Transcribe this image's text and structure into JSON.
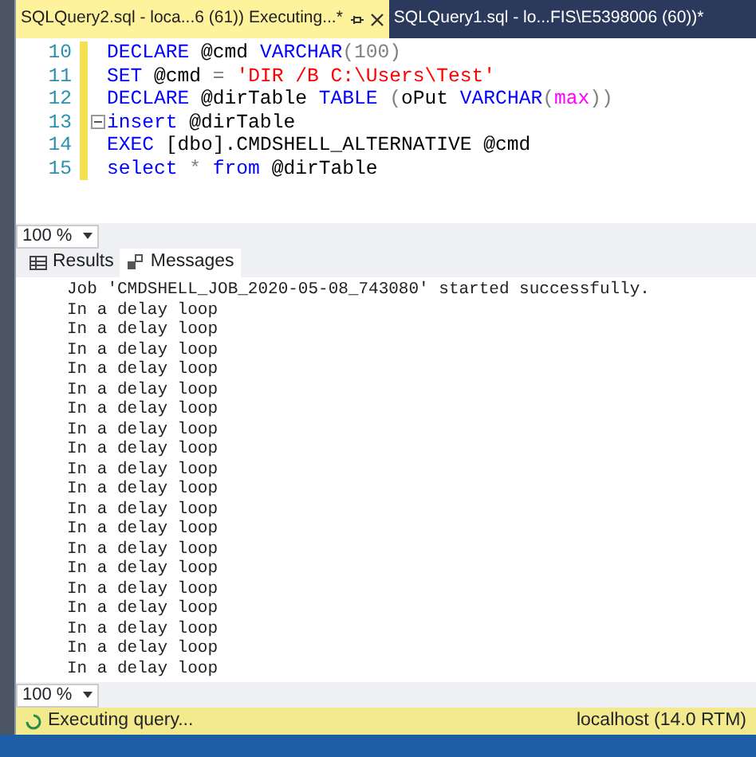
{
  "tabs": [
    {
      "label": "SQLQuery2.sql - loca...6 (61)) Executing...*",
      "selected": true
    },
    {
      "label": "SQLQuery1.sql - lo...FIS\\E5398006 (60))*",
      "selected": false
    }
  ],
  "editor": {
    "lines": [
      {
        "number": "10",
        "collapsible": false,
        "tokens": [
          {
            "text": "DECLARE",
            "kind": "keyword"
          },
          {
            "text": " @cmd ",
            "kind": "plain"
          },
          {
            "text": "VARCHAR",
            "kind": "keyword"
          },
          {
            "text": "(100)",
            "kind": "operator"
          }
        ]
      },
      {
        "number": "11",
        "collapsible": false,
        "tokens": [
          {
            "text": "SET",
            "kind": "keyword"
          },
          {
            "text": " @cmd ",
            "kind": "plain"
          },
          {
            "text": "=",
            "kind": "operator"
          },
          {
            "text": " 'DIR /B C:\\Users\\Test'",
            "kind": "string"
          }
        ]
      },
      {
        "number": "12",
        "collapsible": false,
        "tokens": [
          {
            "text": "DECLARE",
            "kind": "keyword"
          },
          {
            "text": " @dirTable ",
            "kind": "plain"
          },
          {
            "text": "TABLE",
            "kind": "keyword"
          },
          {
            "text": " (",
            "kind": "operator"
          },
          {
            "text": "oPut ",
            "kind": "plain"
          },
          {
            "text": "VARCHAR",
            "kind": "keyword"
          },
          {
            "text": "(",
            "kind": "operator"
          },
          {
            "text": "max",
            "kind": "function"
          },
          {
            "text": "))",
            "kind": "operator"
          }
        ]
      },
      {
        "number": "13",
        "collapsible": true,
        "tokens": [
          {
            "text": "insert",
            "kind": "keyword"
          },
          {
            "text": " @dirTable",
            "kind": "plain"
          }
        ]
      },
      {
        "number": "14",
        "collapsible": false,
        "tokens": [
          {
            "text": "EXEC",
            "kind": "keyword"
          },
          {
            "text": " [dbo].CMDSHELL_ALTERNATIVE @cmd",
            "kind": "plain"
          }
        ]
      },
      {
        "number": "15",
        "collapsible": false,
        "tokens": [
          {
            "text": "select",
            "kind": "keyword"
          },
          {
            "text": " * ",
            "kind": "operator"
          },
          {
            "text": "from",
            "kind": "keyword"
          },
          {
            "text": " @dirTable",
            "kind": "plain"
          }
        ]
      }
    ],
    "zoom": "100 %"
  },
  "result_tabs": [
    {
      "label": "Results",
      "selected": false
    },
    {
      "label": "Messages",
      "selected": true
    }
  ],
  "messages": [
    "Job 'CMDSHELL_JOB_2020-05-08_743080' started successfully.",
    "In a delay loop",
    "In a delay loop",
    "In a delay loop",
    "In a delay loop",
    "In a delay loop",
    "In a delay loop",
    "In a delay loop",
    "In a delay loop",
    "In a delay loop",
    "In a delay loop",
    "In a delay loop",
    "In a delay loop",
    "In a delay loop",
    "In a delay loop",
    "In a delay loop",
    "In a delay loop",
    "In a delay loop",
    "In a delay loop",
    "In a delay loop"
  ],
  "results_zoom": "100 %",
  "status_bar": {
    "status": "Executing query...",
    "server": "localhost (14.0 RTM)"
  }
}
